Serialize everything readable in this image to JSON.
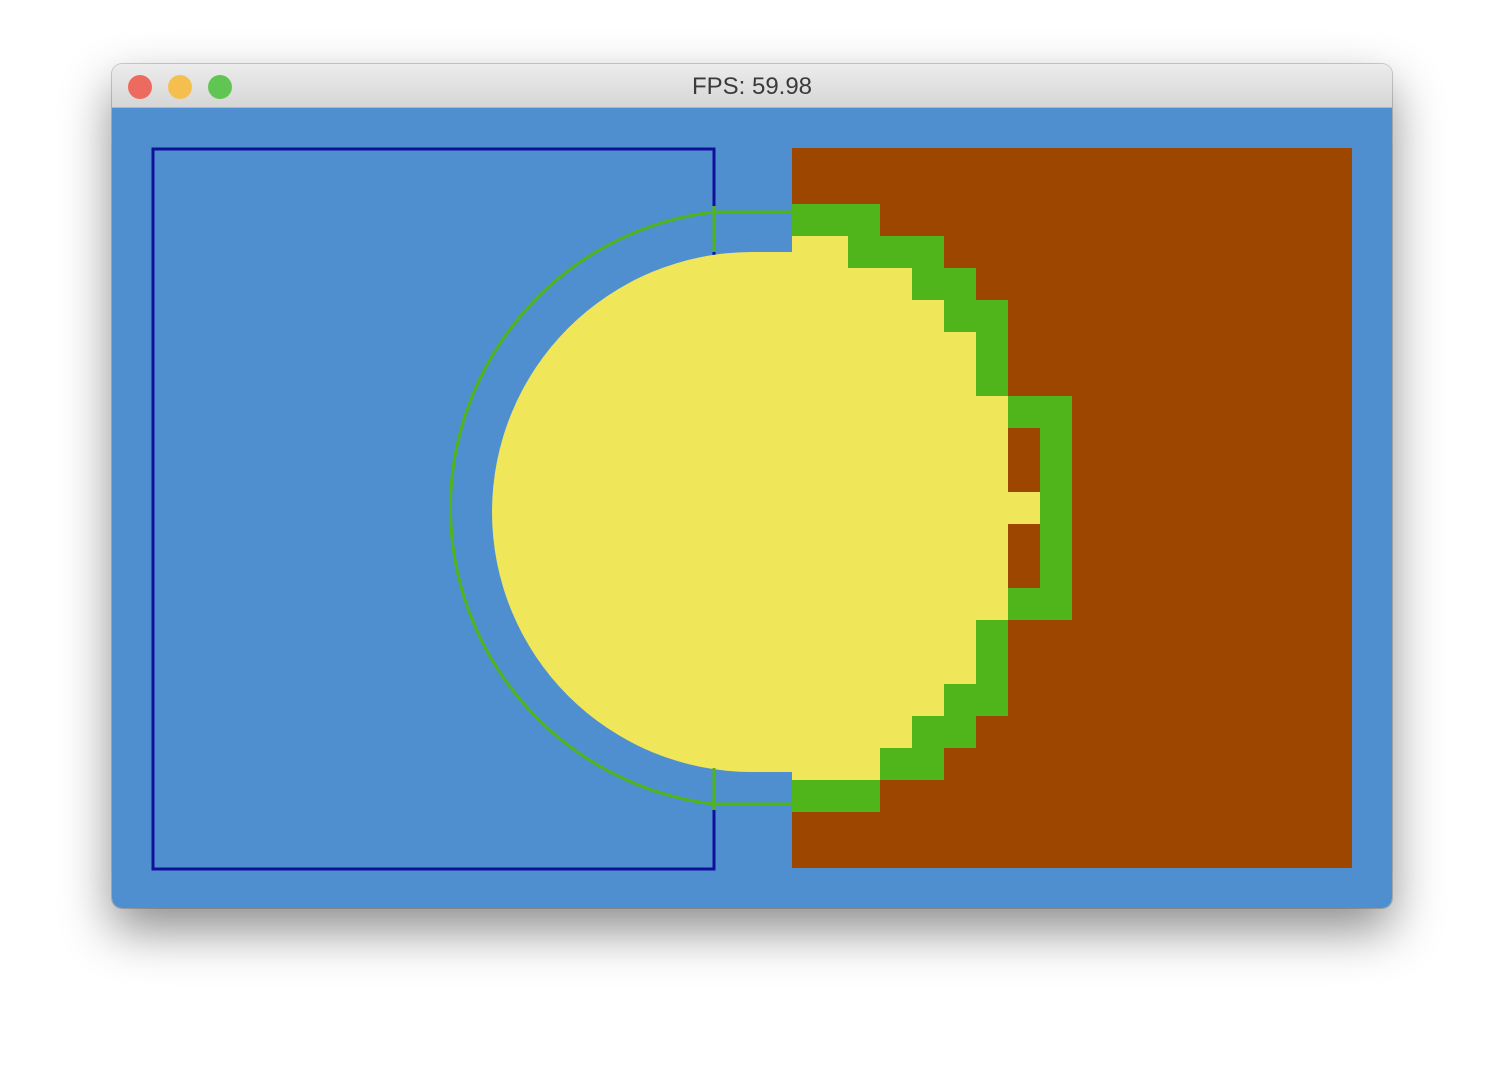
{
  "window": {
    "title": "FPS: 59.98"
  },
  "traffic_lights": {
    "close_color": "#ed6a5e",
    "minimize_color": "#f5bf4f",
    "maximize_color": "#61c554"
  },
  "scene": {
    "colors": {
      "sky": "#4f8fd0",
      "outline_box": "#10109a",
      "dirt": "#9c4600",
      "grass": "#4fb51a",
      "sand": "#f0e65a",
      "circle_outline": "#4fb51a"
    }
  }
}
